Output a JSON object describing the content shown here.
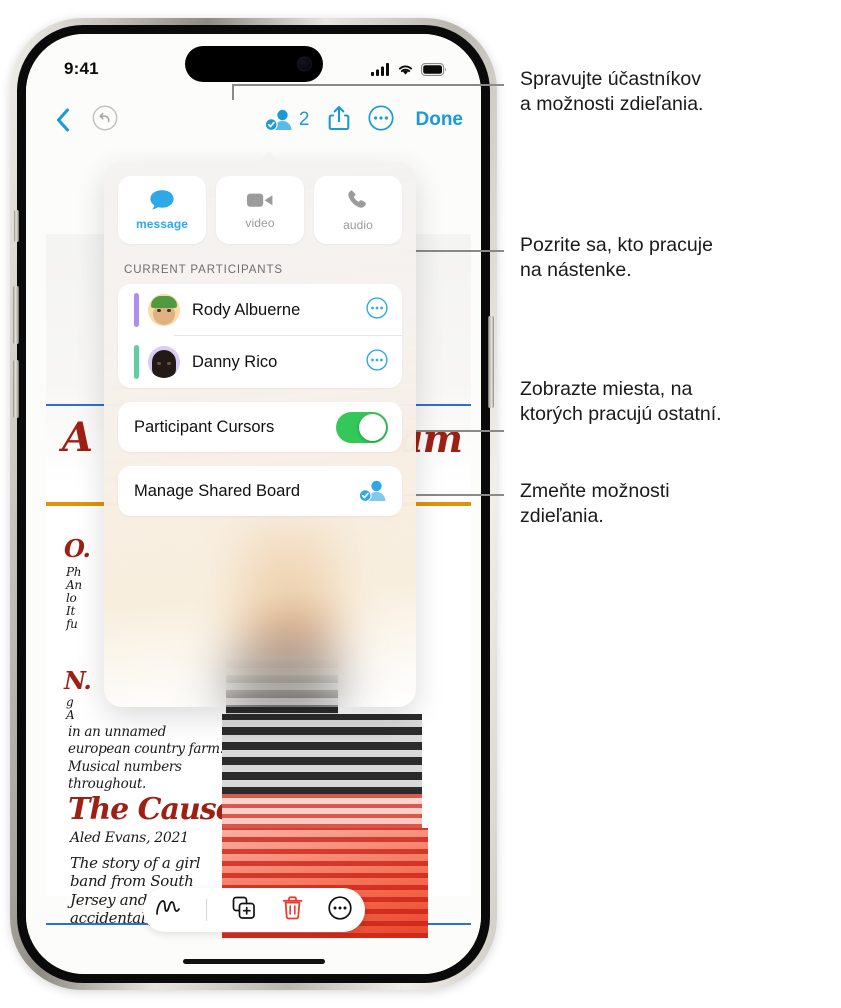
{
  "statusbar": {
    "time": "9:41",
    "cellular": "cellular-bars-icon",
    "wifi": "wifi-icon",
    "battery": "battery-icon"
  },
  "navbar": {
    "back": "back-chevron-icon",
    "undo": "undo-icon",
    "participants_count": "2",
    "participants_icon": "participants-checkmark-icon",
    "share": "share-icon",
    "more": "more-circle-icon",
    "done_label": "Done"
  },
  "popover": {
    "quick_actions": [
      {
        "label": "message",
        "icon": "message-bubble-icon",
        "state": "active"
      },
      {
        "label": "video",
        "icon": "video-camera-icon",
        "state": "dim"
      },
      {
        "label": "audio",
        "icon": "phone-handset-icon",
        "state": "dim"
      }
    ],
    "section_header": "CURRENT PARTICIPANTS",
    "participants": [
      {
        "name": "Rody Albuerne",
        "accent": "#b18cf0",
        "avatar_bg": "#fbd9a8",
        "skin": "#e8b98c",
        "hair": "#4f9b3f",
        "more_icon": "more-circle-icon"
      },
      {
        "name": "Danny Rico",
        "accent": "#5ecfa3",
        "avatar_bg": "#d9cdf5",
        "skin": "#2a1f1a",
        "hair": "#241a15",
        "more_icon": "more-circle-icon"
      }
    ],
    "cursors_row": {
      "label": "Participant Cursors",
      "toggle_on": true,
      "toggle_color": "#34c759"
    },
    "manage_row": {
      "label": "Manage Shared Board",
      "icon": "manage-shared-board-icon"
    }
  },
  "board": {
    "title_fragment": "A",
    "title_fragment_right": "eam",
    "notes": [
      {
        "heading": "O.",
        "lines": [
          "Ph",
          "An",
          "lo",
          "It",
          "fu"
        ]
      },
      {
        "heading": "N.",
        "lines": [
          "g",
          "A"
        ]
      }
    ],
    "synopsis_1": "in an unnamed european country farm. Musical numbers throughout.",
    "entry_title": "The Causes",
    "entry_byline": "Aled Evans, 2021",
    "entry_body": "The story of a girl band from South Jersey and their accidental first tour."
  },
  "toolbar": {
    "items": [
      {
        "icon": "scribble-draw-icon",
        "name": "draw-tool"
      },
      {
        "icon": "duplicate-add-icon",
        "name": "duplicate-tool"
      },
      {
        "icon": "trash-icon",
        "name": "delete-tool",
        "color": "#ef3b2d"
      },
      {
        "icon": "more-circle-icon",
        "name": "more-tool"
      }
    ]
  },
  "callouts": [
    {
      "id": "c1",
      "line1": "Spravujte účastníkov",
      "line2": "a možnosti zdieľania."
    },
    {
      "id": "c2",
      "line1": "Pozrite sa, kto pracuje",
      "line2": "na nástenke."
    },
    {
      "id": "c3",
      "line1": "Zobrazte miesta, na",
      "line2": "ktorých pracujú ostatní."
    },
    {
      "id": "c4",
      "line1": "Zmeňte možnosti",
      "line2": "zdieľania."
    }
  ],
  "colors": {
    "accent_blue": "#1b9ad6",
    "toggle_green": "#34c759",
    "danger_red": "#ef3b2d",
    "leader_gray": "#8a8a8a"
  }
}
